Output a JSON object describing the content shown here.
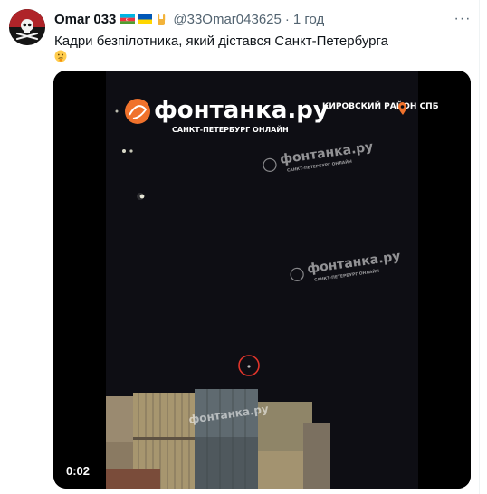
{
  "tweet": {
    "author_name": "Omar 033",
    "flags": [
      "flag-azerbaijan-icon",
      "flag-ukraine-icon"
    ],
    "extra_emoji": "rock-hand-icon",
    "handle": "@33Omar043625",
    "separator": "·",
    "time": "1 год",
    "text": "Кадри безпілотника, який дістався Санкт-Петербурга",
    "trailing_emoji": "thinking-face-icon",
    "more_label": "···"
  },
  "media": {
    "timestamp": "0:02",
    "logo_brand": "фонтанка.ру",
    "logo_tagline": "САНКТ-ПЕТЕРБУРГ ОНЛАЙН",
    "location_label": "КИРОВСКИЙ РАЙОН СПБ",
    "location_icon": "location-pin-icon",
    "watermark_brand": "фонтанка.ру",
    "watermark_tagline": "САНКТ-ПЕТЕРБУРГ ОНЛАЙН"
  },
  "colors": {
    "accent_orange": "#f0722c",
    "drone_circle": "#e0352b",
    "handle_gray": "#536471"
  }
}
